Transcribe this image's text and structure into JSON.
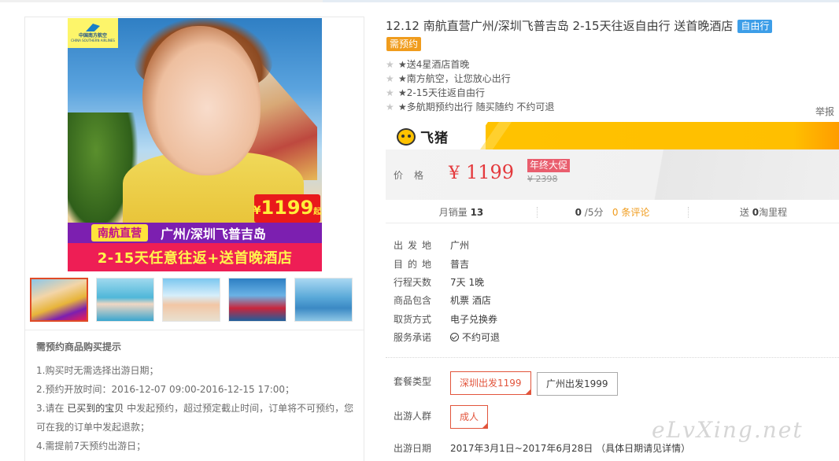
{
  "gallery": {
    "main_image_texts": {
      "airline_cn": "中国南方航空",
      "airline_en": "CHINA SOUTHERN AIRLINES",
      "price_yen": "¥",
      "price_num": "1199",
      "price_suffix": "起",
      "pill": "南航直营",
      "route": "广州/深圳飞普吉岛",
      "bottom": "2-15天任意往返+送首晚酒店"
    },
    "thumbs": [
      {
        "name": "thumb-1",
        "selected": true
      },
      {
        "name": "thumb-2",
        "selected": false
      },
      {
        "name": "thumb-3",
        "selected": false
      },
      {
        "name": "thumb-4",
        "selected": false
      },
      {
        "name": "thumb-5",
        "selected": false
      }
    ]
  },
  "notice": {
    "title": "需预约商品购买提示",
    "line1": "1.购买时无需选择出游日期；",
    "line2": "2.预约开放时间：2016-12-07 09:00-2016-12-15 17:00；",
    "line3_a": "3.请在",
    "line3_hl": "已买到的宝贝",
    "line3_b": "中发起预约，超过预定截止时间，订单将不可预约，您",
    "line4": "可在我的订单中发起退款；",
    "line5": "4.需提前7天预约出游日；"
  },
  "product": {
    "title": "12.12 南航直营广州/深圳飞普吉岛 2-15天往返自由行 送首晚酒店",
    "tag_type": "自由行",
    "tag_booking": "需预约",
    "features": [
      "★送4星酒店首晚",
      "★南方航空，让您放心出行",
      "★2-15天往返自由行",
      "★多航期预约出行 随买随约 不约可退"
    ],
    "report_link": "举报"
  },
  "feizhu": {
    "name": "飞猪"
  },
  "price": {
    "label": "价格",
    "currency": "¥",
    "value": "1199",
    "promo": "年终大促",
    "original": "¥ 2398"
  },
  "stats": {
    "monthly_label": "月销量",
    "monthly_value": "13",
    "rating_value": "0",
    "rating_suffix": "/5分",
    "reviews_count": "0",
    "reviews_label": "条评论",
    "points_prefix": "送",
    "points_value": "0",
    "points_label": "淘里程"
  },
  "details": [
    {
      "key": "出发地",
      "value": "广州"
    },
    {
      "key": "目的地",
      "value": "普吉"
    },
    {
      "key": "行程天数",
      "value": "7天 1晚"
    },
    {
      "key": "商品包含",
      "value": "机票   酒店"
    },
    {
      "key": "取货方式",
      "value": "电子兑换券"
    },
    {
      "key": "服务承诺",
      "value": "不约可退"
    }
  ],
  "options": {
    "package_label": "套餐类型",
    "packages": [
      "深圳出发1199",
      "广州出发1999"
    ],
    "package_selected": 0,
    "traveler_label": "出游人群",
    "travelers": [
      "成人"
    ],
    "date_label": "出游日期",
    "date_value": "2017年3月1日~2017年6月28日  （具体日期请见详情）"
  },
  "watermark": "eLvXing.net",
  "colors": {
    "price_red": "#e4393c",
    "selected_border": "#e2553c",
    "feizhu_yellow": "#ffc200",
    "tag_blue": "#3d9ee8",
    "tag_orange": "#f09c1d"
  }
}
